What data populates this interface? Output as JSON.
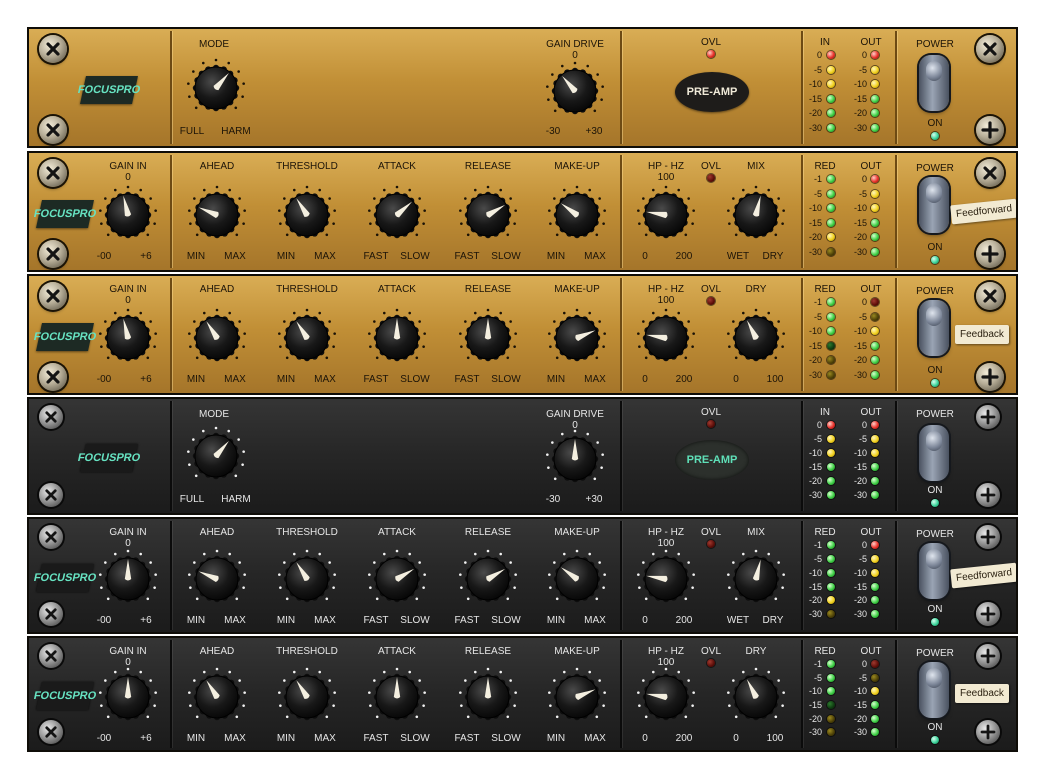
{
  "brand": {
    "line1": "FOCUS",
    "line2": "PRO"
  },
  "labels": {
    "mode": "MODE",
    "gain_drive": "GAIN DRIVE",
    "ovl": "OVL",
    "pre_amp": "PRE-AMP",
    "power": "POWER",
    "on": "ON",
    "gain_in": "GAIN IN",
    "ahead": "AHEAD",
    "threshold": "THRESHOLD",
    "attack": "ATTACK",
    "release": "RELEASE",
    "makeup": "MAKE-UP",
    "hp_hz": "HP - HZ",
    "mix": "MIX",
    "dry": "DRY",
    "in": "IN",
    "out": "OUT",
    "red": "RED",
    "full": "FULL",
    "harm": "HARM",
    "min": "MIN",
    "max": "MAX",
    "fast": "FAST",
    "slow": "SLOW",
    "wet": "WET",
    "neg_inf": "-00",
    "plus6": "+6",
    "zero": "0",
    "minus30": "-30",
    "plus30": "+30",
    "hp_100": "100",
    "hp_200": "200",
    "dry_100": "100"
  },
  "meters": {
    "in_scale": [
      "0",
      "-5",
      "-10",
      "-15",
      "-20",
      "-30"
    ],
    "out_scale": [
      "0",
      "-5",
      "-10",
      "-15",
      "-20",
      "-30"
    ],
    "red_scale": [
      "-1",
      "-5",
      "-10",
      "-15",
      "-20",
      "-30"
    ]
  },
  "tags": {
    "feedforward": "Feedforward",
    "feedback": "Feedback"
  },
  "colors": {
    "gold_panel": "#c6943a",
    "dark_panel": "#262626",
    "logo_text": "#67e3c2",
    "led_red": "#e8302a",
    "led_yellow": "#f2d21e",
    "led_green": "#3fd046"
  },
  "panels": [
    {
      "theme": "gold",
      "type": "preamp",
      "knobs": {
        "mode": 0.65,
        "gain_drive": 0.35
      },
      "ovl": "red",
      "in_leds": [
        "red",
        "yel",
        "yel",
        "grn",
        "grn",
        "grn"
      ],
      "out_leds": [
        "red",
        "yel",
        "yel",
        "grn",
        "grn",
        "grn"
      ]
    },
    {
      "theme": "gold",
      "type": "comp",
      "variant": "mix",
      "tag": "feedforward",
      "knobs": {
        "gain_in": 0.45,
        "ahead": 0.25,
        "threshold": 0.38,
        "attack": 0.68,
        "release": 0.72,
        "makeup": 0.3,
        "hp_hz": 0.2,
        "mix": 0.55
      },
      "ovl": "redoff",
      "red_leds": [
        "grn",
        "grn",
        "grn",
        "grn",
        "yel",
        "yeloff"
      ],
      "out_leds": [
        "red",
        "yel",
        "yel",
        "grn",
        "grn",
        "grn"
      ]
    },
    {
      "theme": "gold",
      "type": "comp",
      "variant": "dry",
      "tag": "feedback",
      "knobs": {
        "gain_in": 0.45,
        "ahead": 0.38,
        "threshold": 0.38,
        "attack": 0.5,
        "release": 0.5,
        "makeup": 0.75,
        "hp_hz": 0.2,
        "dry": 0.4
      },
      "ovl": "redoff",
      "red_leds": [
        "grn",
        "grn",
        "grn",
        "grnoff",
        "yeloff",
        "yeloff"
      ],
      "out_leds": [
        "redoff",
        "yeloff",
        "yel",
        "grn",
        "grn",
        "grn"
      ]
    },
    {
      "theme": "dark",
      "type": "preamp",
      "knobs": {
        "mode": 0.65,
        "gain_drive": 0.5
      },
      "ovl": "redoff",
      "in_leds": [
        "red",
        "yel",
        "yel",
        "grn",
        "grn",
        "grn"
      ],
      "out_leds": [
        "red",
        "yel",
        "yel",
        "grn",
        "grn",
        "grn"
      ]
    },
    {
      "theme": "dark",
      "type": "comp",
      "variant": "mix",
      "tag": "feedforward",
      "knobs": {
        "gain_in": 0.5,
        "ahead": 0.25,
        "threshold": 0.38,
        "attack": 0.72,
        "release": 0.72,
        "makeup": 0.3,
        "hp_hz": 0.2,
        "mix": 0.55
      },
      "ovl": "redoff",
      "red_leds": [
        "grn",
        "grn",
        "grn",
        "grn",
        "yel",
        "yeloff"
      ],
      "out_leds": [
        "red",
        "yel",
        "yel",
        "grn",
        "grn",
        "grn"
      ]
    },
    {
      "theme": "dark",
      "type": "comp",
      "variant": "dry",
      "tag": "feedback",
      "knobs": {
        "gain_in": 0.5,
        "ahead": 0.38,
        "threshold": 0.38,
        "attack": 0.5,
        "release": 0.5,
        "makeup": 0.75,
        "hp_hz": 0.2,
        "dry": 0.4
      },
      "ovl": "redoff",
      "red_leds": [
        "grn",
        "grn",
        "grn",
        "grnoff",
        "yeloff",
        "yeloff"
      ],
      "out_leds": [
        "redoff",
        "yeloff",
        "yel",
        "grn",
        "grn",
        "grn"
      ]
    }
  ]
}
